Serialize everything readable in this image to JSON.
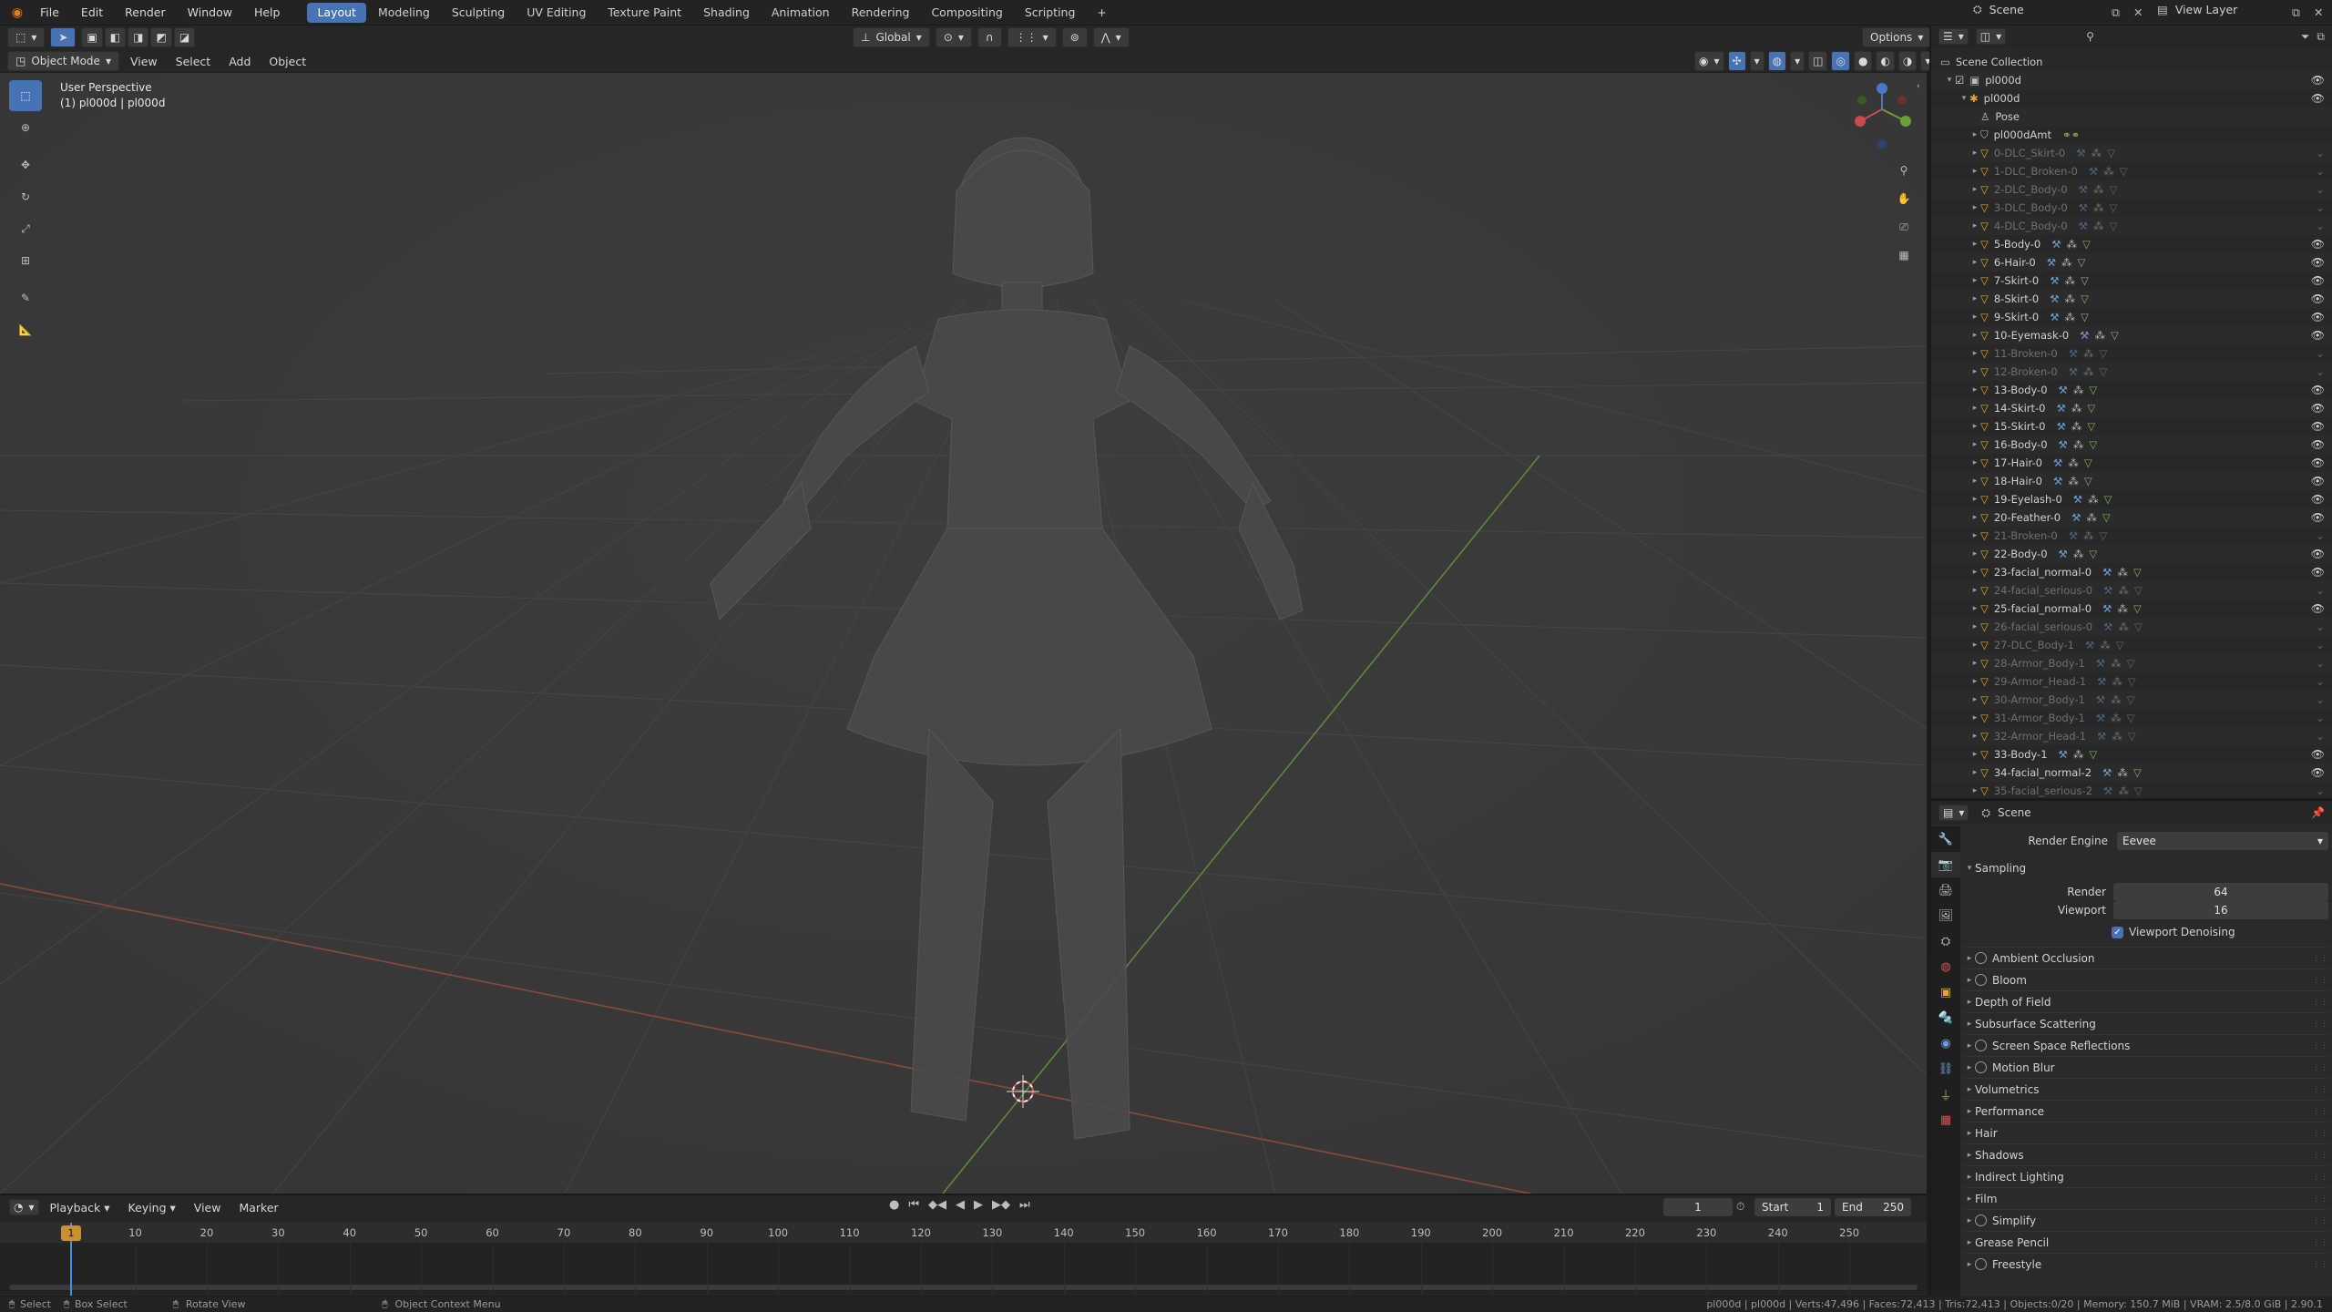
{
  "menubar": {
    "menus": [
      "File",
      "Edit",
      "Render",
      "Window",
      "Help"
    ],
    "workspaces": [
      "Layout",
      "Modeling",
      "Sculpting",
      "UV Editing",
      "Texture Paint",
      "Shading",
      "Animation",
      "Rendering",
      "Compositing",
      "Scripting"
    ],
    "active_workspace": "Layout",
    "add_tab": "+",
    "scene_name": "Scene",
    "view_layer": "View Layer"
  },
  "viewport_header": {
    "mode": "Object Mode",
    "menus": [
      "View",
      "Select",
      "Add",
      "Object"
    ],
    "transform_orientation": "Global",
    "options": "Options"
  },
  "viewport": {
    "perspective": "User Perspective",
    "active_object": "(1) pl000d | pl000d"
  },
  "outliner": {
    "root": "Scene Collection",
    "collection": "pl000d",
    "armature": "pl000d",
    "pose": "Pose",
    "armature_data": "pl000dAmt",
    "items": [
      {
        "name": "0-DLC_Skirt-0",
        "visible": false
      },
      {
        "name": "1-DLC_Broken-0",
        "visible": false
      },
      {
        "name": "2-DLC_Body-0",
        "visible": false
      },
      {
        "name": "3-DLC_Body-0",
        "visible": false
      },
      {
        "name": "4-DLC_Body-0",
        "visible": false
      },
      {
        "name": "5-Body-0",
        "visible": true
      },
      {
        "name": "6-Hair-0",
        "visible": true
      },
      {
        "name": "7-Skirt-0",
        "visible": true
      },
      {
        "name": "8-Skirt-0",
        "visible": true
      },
      {
        "name": "9-Skirt-0",
        "visible": true
      },
      {
        "name": "10-Eyemask-0",
        "visible": true
      },
      {
        "name": "11-Broken-0",
        "visible": false
      },
      {
        "name": "12-Broken-0",
        "visible": false
      },
      {
        "name": "13-Body-0",
        "visible": true
      },
      {
        "name": "14-Skirt-0",
        "visible": true
      },
      {
        "name": "15-Skirt-0",
        "visible": true
      },
      {
        "name": "16-Body-0",
        "visible": true
      },
      {
        "name": "17-Hair-0",
        "visible": true
      },
      {
        "name": "18-Hair-0",
        "visible": true
      },
      {
        "name": "19-Eyelash-0",
        "visible": true
      },
      {
        "name": "20-Feather-0",
        "visible": true
      },
      {
        "name": "21-Broken-0",
        "visible": false
      },
      {
        "name": "22-Body-0",
        "visible": true
      },
      {
        "name": "23-facial_normal-0",
        "visible": true
      },
      {
        "name": "24-facial_serious-0",
        "visible": false
      },
      {
        "name": "25-facial_normal-0",
        "visible": true
      },
      {
        "name": "26-facial_serious-0",
        "visible": false
      },
      {
        "name": "27-DLC_Body-1",
        "visible": false
      },
      {
        "name": "28-Armor_Body-1",
        "visible": false
      },
      {
        "name": "29-Armor_Head-1",
        "visible": false
      },
      {
        "name": "30-Armor_Body-1",
        "visible": false
      },
      {
        "name": "31-Armor_Body-1",
        "visible": false
      },
      {
        "name": "32-Armor_Head-1",
        "visible": false
      },
      {
        "name": "33-Body-1",
        "visible": true
      },
      {
        "name": "34-facial_normal-2",
        "visible": true
      },
      {
        "name": "35-facial_serious-2",
        "visible": false
      }
    ]
  },
  "properties": {
    "context": "Scene",
    "render_engine_label": "Render Engine",
    "render_engine": "Eevee",
    "sampling_label": "Sampling",
    "render_label": "Render",
    "render_samples": "64",
    "viewport_label": "Viewport",
    "viewport_samples": "16",
    "viewport_denoising": "Viewport Denoising",
    "panels": [
      {
        "label": "Ambient Occlusion",
        "toggle": true
      },
      {
        "label": "Bloom",
        "toggle": true
      },
      {
        "label": "Depth of Field",
        "toggle": false
      },
      {
        "label": "Subsurface Scattering",
        "toggle": false
      },
      {
        "label": "Screen Space Reflections",
        "toggle": true
      },
      {
        "label": "Motion Blur",
        "toggle": true
      },
      {
        "label": "Volumetrics",
        "toggle": false
      },
      {
        "label": "Performance",
        "toggle": false
      },
      {
        "label": "Hair",
        "toggle": false
      },
      {
        "label": "Shadows",
        "toggle": false
      },
      {
        "label": "Indirect Lighting",
        "toggle": false
      },
      {
        "label": "Film",
        "toggle": false
      },
      {
        "label": "Simplify",
        "toggle": true
      },
      {
        "label": "Grease Pencil",
        "toggle": false
      },
      {
        "label": "Freestyle",
        "toggle": true
      }
    ]
  },
  "timeline": {
    "menus": [
      "Playback",
      "Keying",
      "View",
      "Marker"
    ],
    "current_frame": "1",
    "start_label": "Start",
    "start": "1",
    "end_label": "End",
    "end": "250",
    "ticks": [
      "1",
      "10",
      "20",
      "30",
      "40",
      "50",
      "60",
      "70",
      "80",
      "90",
      "100",
      "110",
      "120",
      "130",
      "140",
      "150",
      "160",
      "170",
      "180",
      "190",
      "200",
      "210",
      "220",
      "230",
      "240",
      "250"
    ]
  },
  "statusbar": {
    "select": "Select",
    "box_select": "Box Select",
    "rotate_view": "Rotate View",
    "context_menu": "Object Context Menu",
    "stats": "pl000d | pl000d | Verts:47,496 | Faces:72,413 | Tris:72,413 | Objects:0/20 | Memory: 150.7 MiB | VRAM: 2.5/8.0 GiB | 2.90.1"
  }
}
